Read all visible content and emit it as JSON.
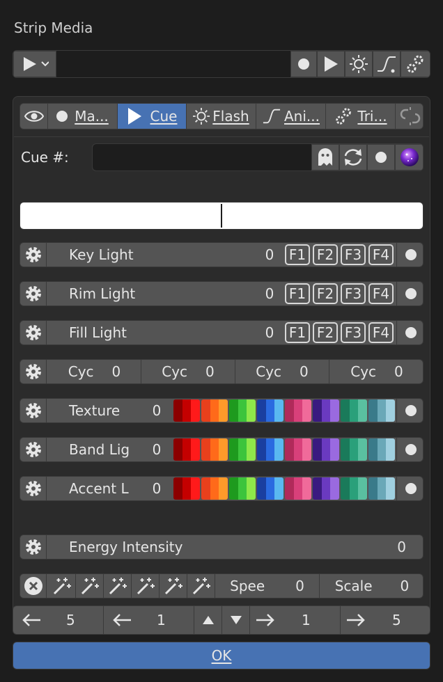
{
  "header": {
    "title": "Strip Media"
  },
  "top_toolbar": {
    "field_value": ""
  },
  "tabs": [
    {
      "label": "Ma...",
      "icon": "record-dot-icon",
      "accel": "M"
    },
    {
      "label": "Cue",
      "icon": "play-icon",
      "accel": "C",
      "active": true
    },
    {
      "label": "Flash",
      "icon": "sun-icon",
      "accel": "F"
    },
    {
      "label": "Ani...",
      "icon": "curve-icon",
      "accel": "A"
    },
    {
      "label": "Tri...",
      "icon": "gears-icon",
      "accel": "T"
    }
  ],
  "cue": {
    "label": "Cue #:",
    "value": ""
  },
  "lights": [
    {
      "name": "Key Light",
      "value": "0",
      "fkeys": [
        "F1",
        "F2",
        "F3",
        "F4"
      ]
    },
    {
      "name": "Rim Light",
      "value": "0",
      "fkeys": [
        "F1",
        "F2",
        "F3",
        "F4"
      ]
    },
    {
      "name": "Fill Light",
      "value": "0",
      "fkeys": [
        "F1",
        "F2",
        "F3",
        "F4"
      ]
    }
  ],
  "cyc": [
    {
      "label": "Cyc",
      "value": "0"
    },
    {
      "label": "Cyc",
      "value": "0"
    },
    {
      "label": "Cyc",
      "value": "0"
    },
    {
      "label": "Cyc",
      "value": "0"
    }
  ],
  "color_rows": [
    {
      "name": "Texture",
      "value": "0"
    },
    {
      "name": "Band Lig",
      "value": "0"
    },
    {
      "name": "Accent L",
      "value": "0"
    }
  ],
  "swatch_colors": [
    [
      "#8b0000",
      "#c40000",
      "#ff1a1a"
    ],
    [
      "#e8401c",
      "#ff6a1a",
      "#ff9a2a"
    ],
    [
      "#1e9a1e",
      "#3cc43c",
      "#8ee84a"
    ],
    [
      "#1a3fa0",
      "#2a6ae0",
      "#5ab8f0"
    ],
    [
      "#b02a5a",
      "#d8407a",
      "#f06a9a"
    ],
    [
      "#3a1a80",
      "#6a3ac0",
      "#9a6ae0"
    ],
    [
      "#1a7a5a",
      "#2aa07a",
      "#5ac0a0"
    ],
    [
      "#3a7a8a",
      "#6aa8b8",
      "#a0d0e0"
    ]
  ],
  "energy": {
    "label": "Energy Intensity",
    "value": "0"
  },
  "bottom_row": {
    "speed_label": "Spee",
    "speed_value": "0",
    "scale_label": "Scale",
    "scale_value": "0"
  },
  "nav": {
    "left_far": "5",
    "left_near": "1",
    "right_near": "1",
    "right_far": "5"
  },
  "ok": {
    "label": "OK",
    "accel": "O"
  },
  "colors": {
    "accent": "#4772b3",
    "widget": "#545454",
    "panel": "#2b2b2b",
    "background": "#1d1d1d"
  }
}
